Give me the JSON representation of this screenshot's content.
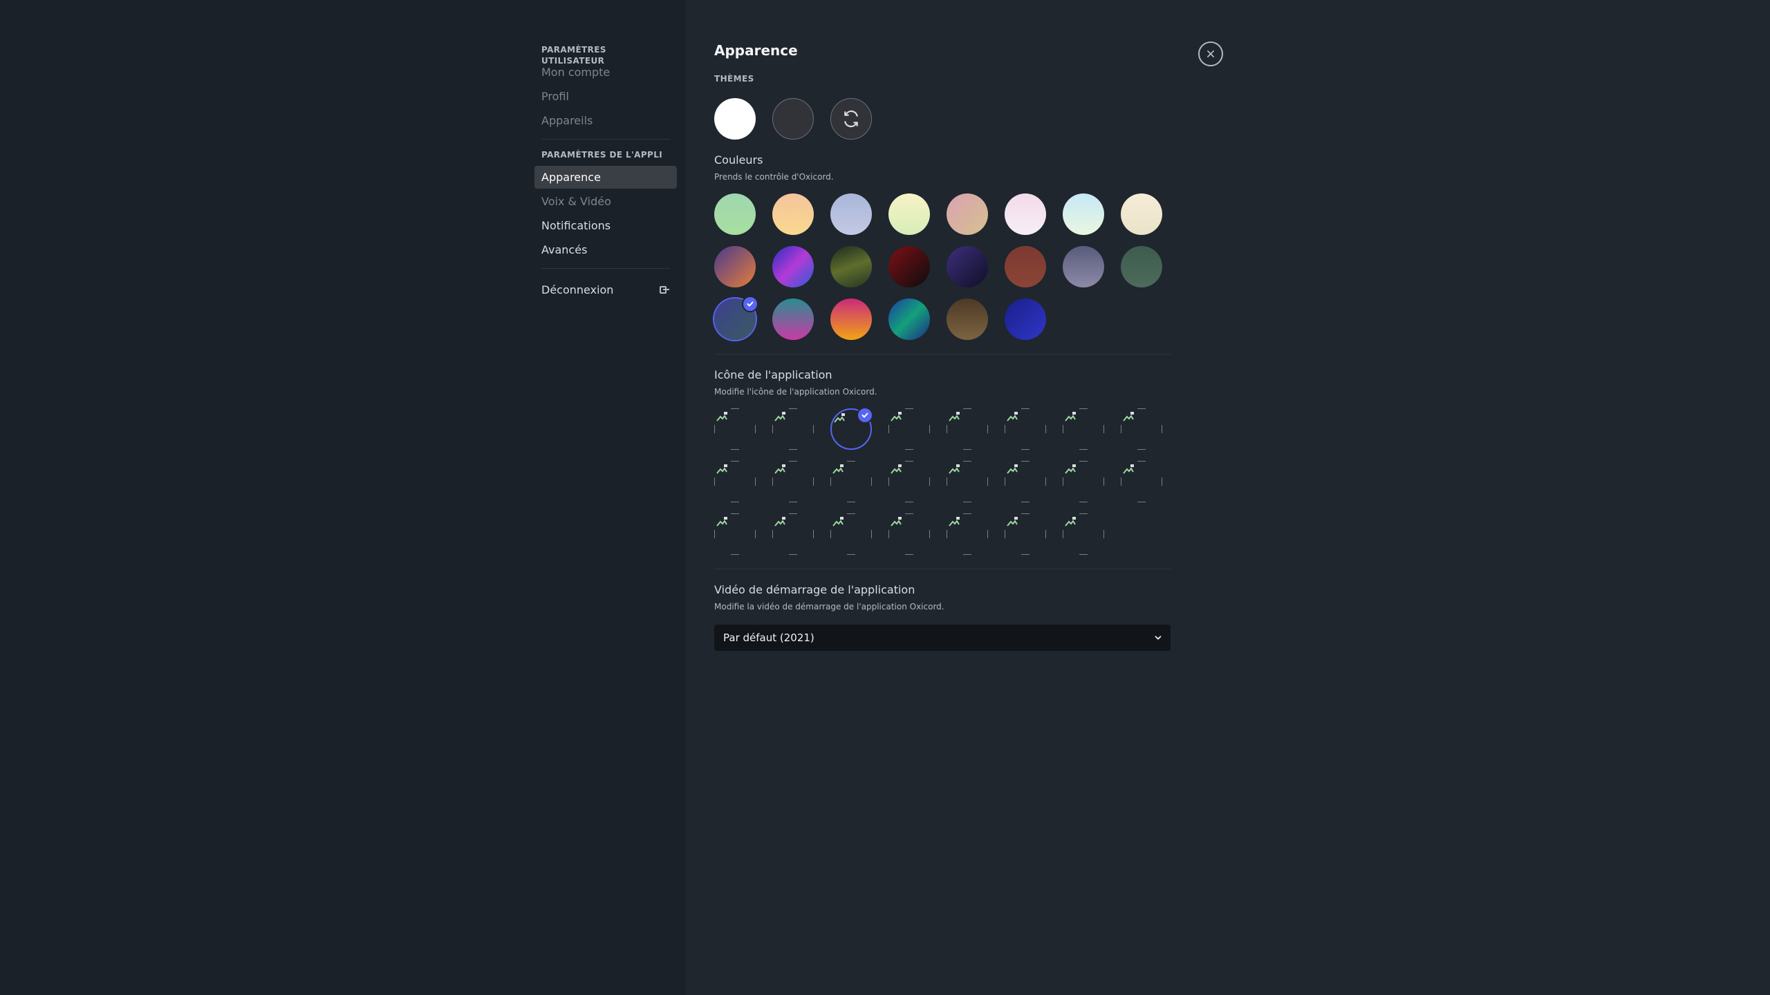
{
  "sidebar": {
    "user_settings_header": "PARAMÈTRES UTILISATEUR",
    "user_items": [
      {
        "label": "Mon compte"
      },
      {
        "label": "Profil"
      },
      {
        "label": "Appareils"
      }
    ],
    "app_settings_header": "PARAMÈTRES DE L'APPLI",
    "app_items": [
      {
        "label": "Apparence",
        "active": true
      },
      {
        "label": "Voix & Vidéo"
      },
      {
        "label": "Notifications"
      },
      {
        "label": "Avancés"
      }
    ],
    "logout_label": "Déconnexion",
    "logout_icon": "logout-icon"
  },
  "main": {
    "title": "Apparence",
    "themes_header": "THÈMES",
    "themes": [
      {
        "name": "light-theme",
        "color": "#ffffff"
      },
      {
        "name": "dark-theme",
        "color": "#313338"
      },
      {
        "name": "sync-theme",
        "icon": "sync-icon"
      }
    ],
    "colors": {
      "title": "Couleurs",
      "subtitle": "Prends le contrôle d'Oxicord.",
      "selected_index": 16,
      "swatches": [
        "linear-gradient(180deg,#9fd6b0,#a8dfa0)",
        "linear-gradient(180deg,#f5c49c,#f9d98f)",
        "linear-gradient(180deg,#a9b6d9,#c4c9e4)",
        "linear-gradient(180deg,#f7f2c7,#d8eeb8)",
        "linear-gradient(135deg,#d9a3b3,#d6c08e)",
        "linear-gradient(180deg,#f3dbe9,#f6eef6)",
        "linear-gradient(180deg,#c7e8f7,#e9f7e0)",
        "linear-gradient(180deg,#f4ecd8,#ebe3c8)",
        "linear-gradient(135deg,#4b3a8e,#e47d3a)",
        "linear-gradient(135deg,#2a2fbf,#b33ad6,#2a5cd6)",
        "linear-gradient(160deg,#1d2a1f,#5f6e2c,#253524)",
        "linear-gradient(135deg,#7d1018,#0c0c0c)",
        "linear-gradient(135deg,#3d2f7c,#0f0f26)",
        "linear-gradient(180deg,#7d3a32,#8b4436)",
        "linear-gradient(180deg,#595b7c,#8d8aa7)",
        "linear-gradient(180deg,#3e5c4f,#4c6b5a)",
        "linear-gradient(135deg,#3c3f8f,#3a5b61)",
        "linear-gradient(180deg,#2a8d90,#c93ba6)",
        "linear-gradient(180deg,#c92a7b,#f2a416)",
        "linear-gradient(135deg,#1a3fa5,#14a07a,#1d2a8a)",
        "linear-gradient(180deg,#4d3a25,#7c6441)",
        "linear-gradient(135deg,#1a1f8a,#3036c6)"
      ]
    },
    "app_icon": {
      "title": "Icône de l'application",
      "subtitle": "Modifie l'icône de l'application Oxicord.",
      "count": 23,
      "selected_index": 2
    },
    "startup_video": {
      "title": "Vidéo de démarrage de l'application",
      "subtitle": "Modifie la vidéo de démarrage de l'application Oxicord.",
      "selected": "Par défaut (2021)"
    },
    "close_icon": "close-icon"
  }
}
